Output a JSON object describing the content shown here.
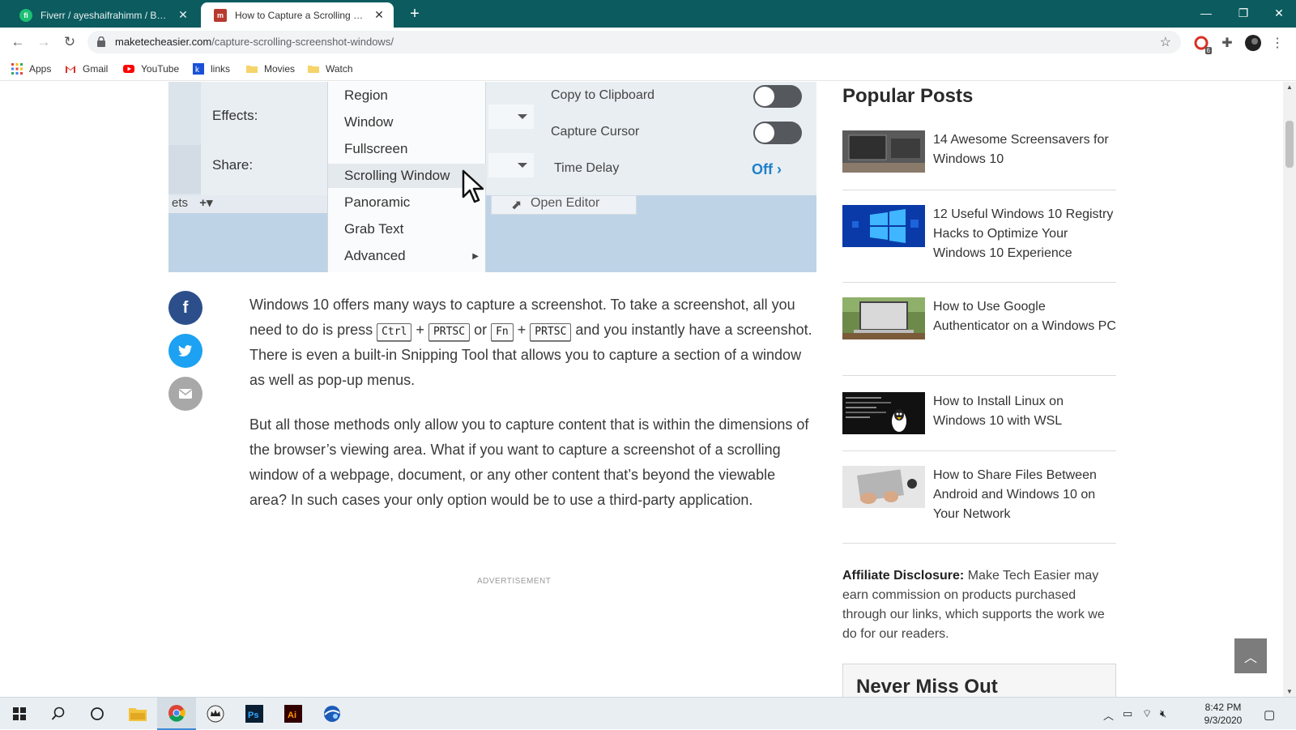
{
  "browser": {
    "tabs": [
      {
        "label": "Fiverr / ayeshaifrahimm / Buyer R",
        "favicon": "fiverr-icon",
        "color": "#1dbf73"
      },
      {
        "label": "How to Capture a Scrolling Scree",
        "favicon": "mte-icon",
        "color": "#c0392b"
      }
    ],
    "url_host": "maketecheasier.com",
    "url_path": "/capture-scrolling-screenshot-windows/",
    "bookmarks": [
      {
        "label": "Apps",
        "icon": "apps-grid-icon"
      },
      {
        "label": "Gmail",
        "icon": "gmail-icon"
      },
      {
        "label": "YouTube",
        "icon": "youtube-icon"
      },
      {
        "label": "links",
        "icon": "links-icon"
      },
      {
        "label": "Movies",
        "icon": "folder-icon"
      },
      {
        "label": "Watch",
        "icon": "folder-icon"
      }
    ],
    "extension_badge": "6"
  },
  "article_image": {
    "labels": {
      "effects": "Effects:",
      "share": "Share:",
      "open_editor": "Open Editor",
      "presets": "ets"
    },
    "menu_items": [
      "Region",
      "Window",
      "Fullscreen",
      "Scrolling Window",
      "Panoramic",
      "Grab Text",
      "Advanced"
    ],
    "highlighted_item": "Scrolling Window",
    "options": [
      {
        "label": "Copy to Clipboard",
        "control": "toggle"
      },
      {
        "label": "Capture Cursor",
        "control": "toggle"
      },
      {
        "label": "Time Delay",
        "value": "Off"
      }
    ]
  },
  "article": {
    "para1": {
      "t1": "Windows 10 offers many ways to capture a screenshot. To take a screenshot, all you need to do is press ",
      "k1": "Ctrl",
      "p1": " + ",
      "k2": "PRTSC",
      "or": " or ",
      "k3": "Fn",
      "p2": " + ",
      "k4": "PRTSC",
      "t2": " and you instantly have a screenshot. There is even a built-in Snipping Tool that allows you to capture a section of a window as well as pop-up menus."
    },
    "para2": "But all those methods only allow you to capture content that is within the dimensions of the browser’s viewing area. What if you want to capture a screenshot of a scrolling window of a webpage, document, or any other content that’s beyond the viewable area? In such cases your only option would be to use a third-party application.",
    "advertisement": "ADVERTISEMENT"
  },
  "share_buttons": [
    {
      "name": "facebook",
      "glyph": "f",
      "color": "#2c4f8c"
    },
    {
      "name": "twitter",
      "glyph": "t",
      "color": "#1da1f2"
    },
    {
      "name": "email",
      "glyph": "✉",
      "color": "#a8a8a8"
    }
  ],
  "sidebar": {
    "title": "Popular Posts",
    "posts": [
      "14 Awesome Screensavers for Windows 10",
      "12 Useful Windows 10 Registry Hacks to Optimize Your Windows 10 Experience",
      "How to Use Google Authenticator on a Windows PC",
      "How to Install Linux on Windows 10 with WSL",
      "How to Share Files Between Android and Windows 10 on Your Network"
    ],
    "disclosure_label": "Affiliate Disclosure:",
    "disclosure_text": " Make Tech Easier may earn commission on products purchased through our links, which supports the work we do for our readers.",
    "never_miss": "Never Miss Out"
  },
  "taskbar": {
    "time": "8:42 PM",
    "date": "9/3/2020"
  }
}
